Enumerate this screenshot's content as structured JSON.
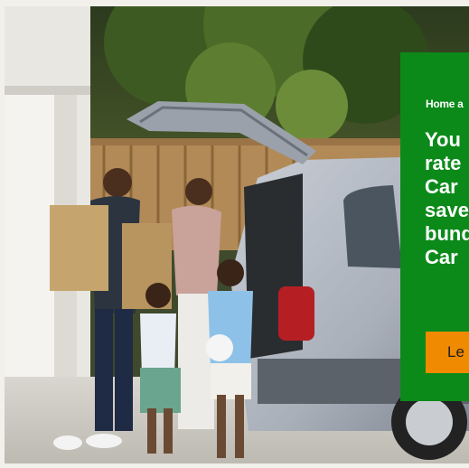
{
  "promo": {
    "eyebrow": "Home a",
    "headline_lines": [
      "You",
      "rate",
      "Car",
      "save",
      "bund",
      "Car"
    ],
    "cta_label": "Le"
  },
  "colors": {
    "panel_green": "#0b8a1a",
    "cta_orange": "#f08a00",
    "headline_text": "#ffffff"
  }
}
